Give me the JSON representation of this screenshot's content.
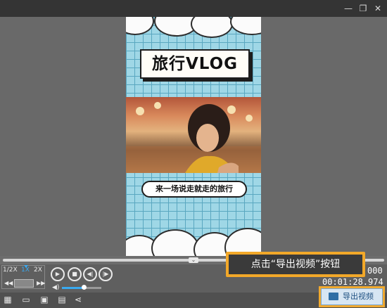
{
  "window": {
    "controls": [
      "minimize-icon",
      "restore-icon",
      "close-icon"
    ]
  },
  "poster": {
    "title": "旅行VLOG",
    "caption": "来一场说走就走的旅行",
    "colors": {
      "sky": "#9fd7e6",
      "grid": "#5aa7c0"
    }
  },
  "playback": {
    "speeds": [
      "1/2X",
      "1X",
      "2X"
    ],
    "active_speed": "1X",
    "time_top": "000",
    "time_bottom": "00:01:28.974",
    "volume_level": 0.55
  },
  "tooltip": {
    "text": "点击“导出视频”按钮"
  },
  "export": {
    "label": "导出视频"
  }
}
